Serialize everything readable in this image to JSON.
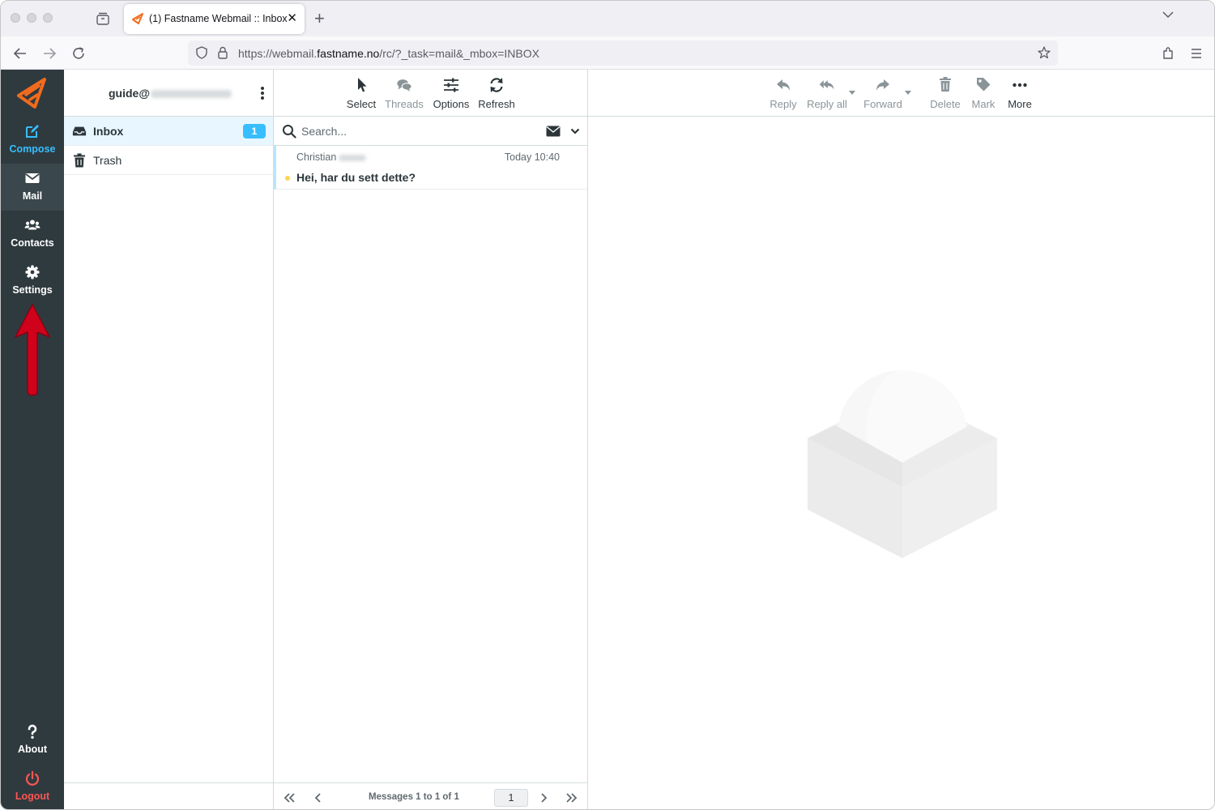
{
  "browser": {
    "tab_title": "(1) Fastname Webmail :: Inbox",
    "url_prefix": "https://webmail.",
    "url_domain": "fastname.no",
    "url_suffix": "/rc/?_task=mail&_mbox=INBOX"
  },
  "rail": {
    "items": [
      {
        "label": "Compose",
        "icon": "compose-icon"
      },
      {
        "label": "Mail",
        "icon": "envelope-icon"
      },
      {
        "label": "Contacts",
        "icon": "users-icon"
      },
      {
        "label": "Settings",
        "icon": "gear-icon"
      }
    ],
    "about_label": "About",
    "logout_label": "Logout"
  },
  "folders": {
    "account": "guide@",
    "items": [
      {
        "name": "Inbox",
        "unread": "1",
        "icon": "inbox-icon"
      },
      {
        "name": "Trash",
        "icon": "trash-icon"
      }
    ]
  },
  "list_toolbar": {
    "select": "Select",
    "threads": "Threads",
    "options": "Options",
    "refresh": "Refresh"
  },
  "search": {
    "placeholder": "Search..."
  },
  "messages": [
    {
      "from": "Christian",
      "date": "Today 10:40",
      "subject": "Hei, har du sett dette?",
      "unread": true
    }
  ],
  "pagination": {
    "count_text": "Messages 1 to 1 of 1",
    "page": "1"
  },
  "message_toolbar": {
    "reply": "Reply",
    "reply_all": "Reply all",
    "forward": "Forward",
    "delete": "Delete",
    "mark": "Mark",
    "more": "More"
  },
  "colors": {
    "accent": "#37beff",
    "rail_bg": "#2f3a3f",
    "logout": "#ff5552",
    "brand": "#f26b1d",
    "annotation_arrow": "#d0021b"
  }
}
